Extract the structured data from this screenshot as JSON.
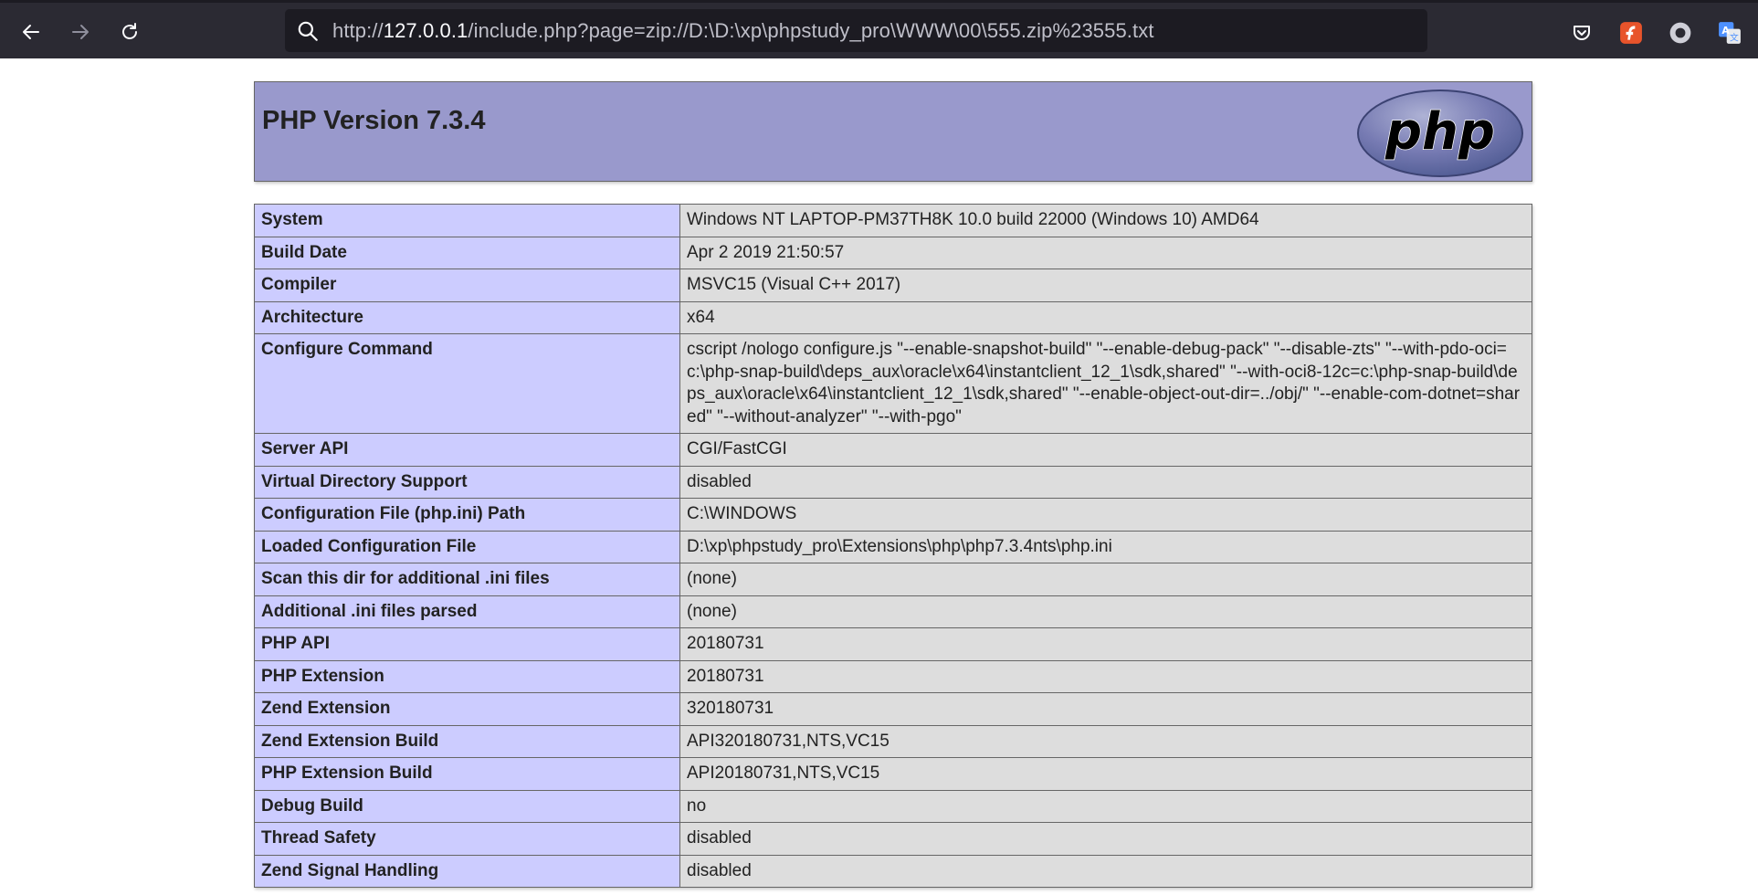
{
  "browser": {
    "url_prefix": "http://",
    "url_host": "127.0.0.1",
    "url_path": "/include.php?page=zip://D:\\D:\\xp\\phpstudy_pro\\WWW\\00\\555.zip%23555.txt",
    "icons": [
      "back-arrow-icon",
      "forward-arrow-icon",
      "reload-icon",
      "search-icon",
      "pocket-icon",
      "flash-extension-icon",
      "circle-extension-icon",
      "translate-icon"
    ]
  },
  "phpinfo": {
    "title": "PHP Version 7.3.4",
    "logo_text": "php",
    "rows": [
      {
        "key": "System",
        "value": "Windows NT LAPTOP-PM37TH8K 10.0 build 22000 (Windows 10) AMD64"
      },
      {
        "key": "Build Date",
        "value": "Apr 2 2019 21:50:57"
      },
      {
        "key": "Compiler",
        "value": "MSVC15 (Visual C++ 2017)"
      },
      {
        "key": "Architecture",
        "value": "x64"
      },
      {
        "key": "Configure Command",
        "value": "cscript /nologo configure.js \"--enable-snapshot-build\" \"--enable-debug-pack\" \"--disable-zts\" \"--with-pdo-oci=c:\\php-snap-build\\deps_aux\\oracle\\x64\\instantclient_12_1\\sdk,shared\" \"--with-oci8-12c=c:\\php-snap-build\\deps_aux\\oracle\\x64\\instantclient_12_1\\sdk,shared\" \"--enable-object-out-dir=../obj/\" \"--enable-com-dotnet=shared\" \"--without-analyzer\" \"--with-pgo\""
      },
      {
        "key": "Server API",
        "value": "CGI/FastCGI"
      },
      {
        "key": "Virtual Directory Support",
        "value": "disabled"
      },
      {
        "key": "Configuration File (php.ini) Path",
        "value": "C:\\WINDOWS"
      },
      {
        "key": "Loaded Configuration File",
        "value": "D:\\xp\\phpstudy_pro\\Extensions\\php\\php7.3.4nts\\php.ini"
      },
      {
        "key": "Scan this dir for additional .ini files",
        "value": "(none)"
      },
      {
        "key": "Additional .ini files parsed",
        "value": "(none)"
      },
      {
        "key": "PHP API",
        "value": "20180731"
      },
      {
        "key": "PHP Extension",
        "value": "20180731"
      },
      {
        "key": "Zend Extension",
        "value": "320180731"
      },
      {
        "key": "Zend Extension Build",
        "value": "API320180731,NTS,VC15"
      },
      {
        "key": "PHP Extension Build",
        "value": "API20180731,NTS,VC15"
      },
      {
        "key": "Debug Build",
        "value": "no"
      },
      {
        "key": "Thread Safety",
        "value": "disabled"
      },
      {
        "key": "Zend Signal Handling",
        "value": "disabled"
      }
    ]
  }
}
